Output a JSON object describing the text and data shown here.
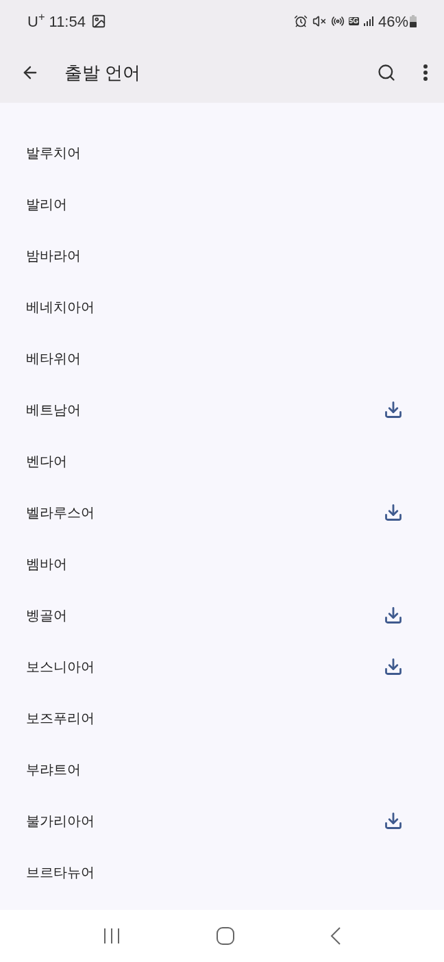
{
  "status_bar": {
    "carrier": "U$^{+}$",
    "time": "11:54",
    "network": "5G",
    "battery": "46%"
  },
  "app_bar": {
    "title": "출발 언어"
  },
  "languages": [
    {
      "name": "발루치어",
      "downloadable": false
    },
    {
      "name": "발리어",
      "downloadable": false
    },
    {
      "name": "밤바라어",
      "downloadable": false
    },
    {
      "name": "베네치아어",
      "downloadable": false
    },
    {
      "name": "베타위어",
      "downloadable": false
    },
    {
      "name": "베트남어",
      "downloadable": true
    },
    {
      "name": "벤다어",
      "downloadable": false
    },
    {
      "name": "벨라루스어",
      "downloadable": true
    },
    {
      "name": "벰바어",
      "downloadable": false
    },
    {
      "name": "벵골어",
      "downloadable": true
    },
    {
      "name": "보스니아어",
      "downloadable": true
    },
    {
      "name": "보즈푸리어",
      "downloadable": false
    },
    {
      "name": "부랴트어",
      "downloadable": false
    },
    {
      "name": "불가리아어",
      "downloadable": true
    },
    {
      "name": "브르타뉴어",
      "downloadable": false
    }
  ]
}
